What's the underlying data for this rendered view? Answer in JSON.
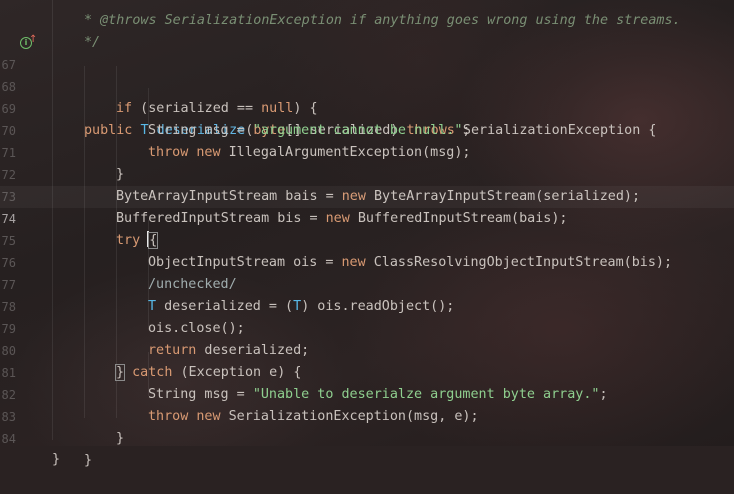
{
  "editor": {
    "theme": "dark-anime-background",
    "current_line": "74",
    "gutter_icon": "implementation-marker-icon"
  },
  "lines": [
    {
      "n": "",
      "text": "* @throws SerializationException if anything goes wrong using the streams."
    },
    {
      "n": "",
      "text": "*/"
    },
    {
      "n": "67",
      "text": "public T deserialize(byte[] serialized) throws SerializationException {"
    },
    {
      "n": "68",
      "text": "if (serialized == null) {"
    },
    {
      "n": "69",
      "text": "String msg = \"argument cannot be null.\";"
    },
    {
      "n": "70",
      "text": "throw new IllegalArgumentException(msg);"
    },
    {
      "n": "71",
      "text": "}"
    },
    {
      "n": "72",
      "text": "ByteArrayInputStream bais = new ByteArrayInputStream(serialized);"
    },
    {
      "n": "73",
      "text": "BufferedInputStream bis = new BufferedInputStream(bais);"
    },
    {
      "n": "74",
      "text": "try {"
    },
    {
      "n": "75",
      "text": "ObjectInputStream ois = new ClassResolvingObjectInputStream(bis);"
    },
    {
      "n": "76",
      "text": "/unchecked/"
    },
    {
      "n": "77",
      "text": "T deserialized = (T) ois.readObject();"
    },
    {
      "n": "78",
      "text": "ois.close();"
    },
    {
      "n": "79",
      "text": "return deserialized;"
    },
    {
      "n": "80",
      "text": "} catch (Exception e) {"
    },
    {
      "n": "81",
      "text": "String msg = \"Unable to deserialze argument byte array.\";"
    },
    {
      "n": "82",
      "text": "throw new SerializationException(msg, e);"
    },
    {
      "n": "83",
      "text": "}"
    },
    {
      "n": "84",
      "text": "}"
    },
    {
      "n": "",
      "text": "}"
    }
  ]
}
